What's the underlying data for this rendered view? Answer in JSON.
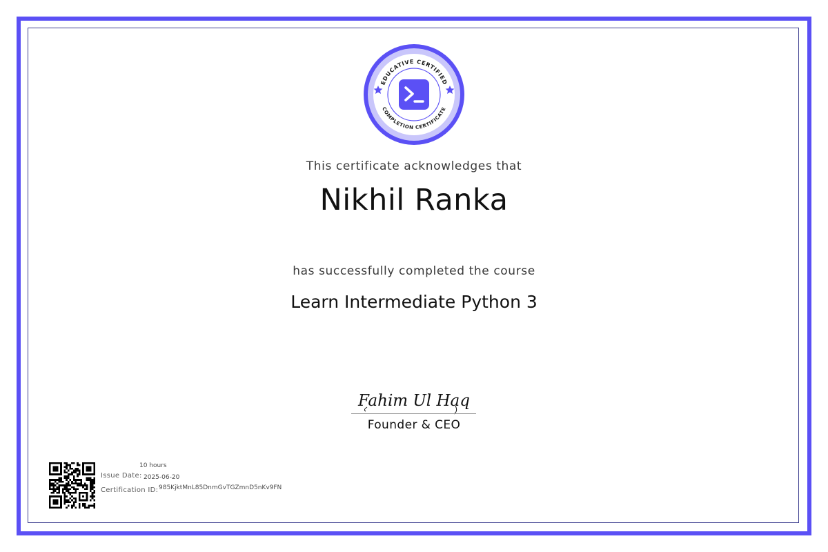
{
  "seal": {
    "top_text": "EDUCATIVE CERTIFIED",
    "bottom_text": "COMPLETION CERTIFICATE",
    "accent_color": "#5b50f5",
    "icon": "terminal-icon"
  },
  "certificate": {
    "acknowledges": "This certificate acknowledges that",
    "recipient_name": "Nikhil Ranka",
    "completed_text": "has successfully completed the course",
    "course_name": "Learn Intermediate Python 3"
  },
  "signatory": {
    "signature": "Fahim Ul Haq",
    "title": "Founder & CEO"
  },
  "details": {
    "duration": "10 hours",
    "issue_date_label": "Issue Date:",
    "issue_date": "2025-06-20",
    "cert_id_label": "Certification ID:",
    "cert_id": "985KjktMnL85DnmGvTGZmnD5nKv9FN"
  },
  "colors": {
    "border": "#5b50f5",
    "inner_border": "#3c3d8f"
  }
}
